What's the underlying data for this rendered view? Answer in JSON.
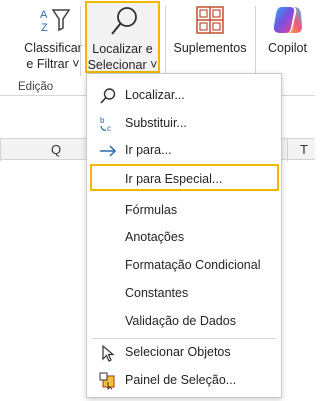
{
  "ribbon": {
    "sort_filter": {
      "line1": "Classificar",
      "line2": "e Filtrar",
      "arrow": "˅"
    },
    "find_select": {
      "line1": "Localizar e",
      "line2": "Selecionar",
      "arrow": "˅"
    },
    "addins": {
      "label": "Suplementos"
    },
    "copilot": {
      "label": "Copilot"
    },
    "group_label": "Edição"
  },
  "sheet": {
    "col_q": "Q",
    "col_t": "T"
  },
  "menu": {
    "items": [
      {
        "label": "Localizar...",
        "icon": "magnifier-icon"
      },
      {
        "label": "Substituir...",
        "icon": "replace-icon"
      },
      {
        "label": "Ir para...",
        "icon": "arrow-right-icon"
      },
      {
        "label": "Ir para Especial...",
        "icon": ""
      },
      {
        "label": "Fórmulas",
        "icon": ""
      },
      {
        "label": "Anotações",
        "icon": ""
      },
      {
        "label": "Formatação Condicional",
        "icon": ""
      },
      {
        "label": "Constantes",
        "icon": ""
      },
      {
        "label": "Validação de Dados",
        "icon": ""
      },
      {
        "label": "Selecionar Objetos",
        "icon": "cursor-icon"
      },
      {
        "label": "Painel de Seleção...",
        "icon": "selection-pane-icon"
      }
    ]
  },
  "colors": {
    "highlight": "#f0b800",
    "accent_blue": "#2b6cb0"
  }
}
